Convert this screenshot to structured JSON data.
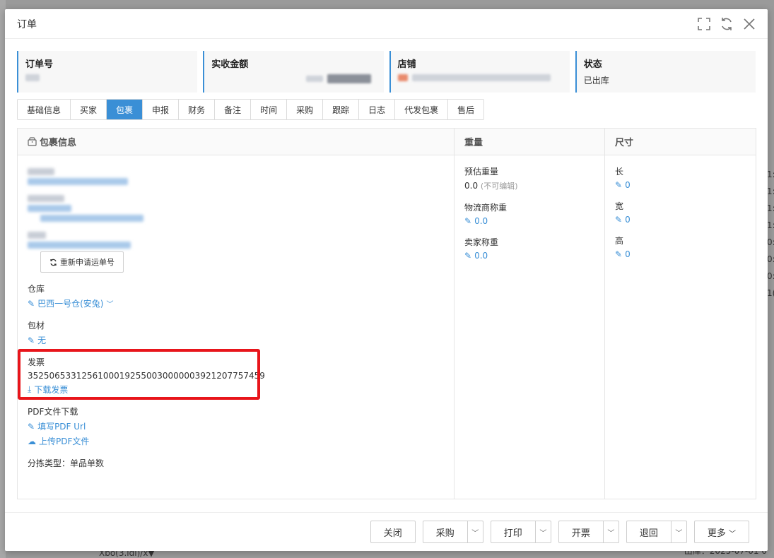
{
  "background": {
    "right_col": [
      "1:",
      "1:",
      "1:",
      "1:",
      "0:",
      "0:",
      "0:",
      "1("
    ],
    "bottom_left": "Xbo(3.ldi)/x▼",
    "bottom_right": "出库：2025-07-01 0"
  },
  "modal": {
    "title": "订单",
    "icons": {
      "fullscreen": "fullscreen-icon",
      "refresh": "refresh-icon",
      "close": "close-icon"
    }
  },
  "summary": {
    "order_no": {
      "label": "订单号"
    },
    "amount": {
      "label": "实收金额"
    },
    "shop": {
      "label": "店铺"
    },
    "status": {
      "label": "状态",
      "value": "已出库"
    }
  },
  "tabs": [
    {
      "label": "基础信息"
    },
    {
      "label": "买家"
    },
    {
      "label": "包裹",
      "active": true
    },
    {
      "label": "申报"
    },
    {
      "label": "财务"
    },
    {
      "label": "备注"
    },
    {
      "label": "时间"
    },
    {
      "label": "采购"
    },
    {
      "label": "跟踪"
    },
    {
      "label": "日志"
    },
    {
      "label": "代发包裹"
    },
    {
      "label": "售后"
    }
  ],
  "package_info": {
    "header": "包裹信息",
    "reapply_button": "重新申请运单号",
    "warehouse": {
      "label": "仓库",
      "value": "巴西一号仓(安兔)"
    },
    "packaging": {
      "label": "包材",
      "value": "无"
    },
    "invoice": {
      "label": "发票",
      "value": "35250653312561000192550030000003921207757459",
      "download": "下载发票"
    },
    "pdf": {
      "label": "PDF文件下载",
      "fill_url": "填写PDF Url",
      "upload": "上传PDF文件"
    },
    "sort_type": "分拣类型：单品单数"
  },
  "weight": {
    "header": "重量",
    "estimated": {
      "label": "预估重量",
      "value": "0.0",
      "note": "(不可编辑)"
    },
    "carrier": {
      "label": "物流商称重",
      "value": "0.0"
    },
    "seller": {
      "label": "卖家称重",
      "value": "0.0"
    }
  },
  "size": {
    "header": "尺寸",
    "length": {
      "label": "长",
      "value": "0"
    },
    "width": {
      "label": "宽",
      "value": "0"
    },
    "height": {
      "label": "高",
      "value": "0"
    }
  },
  "footer": {
    "close": "关闭",
    "purchase": "采购",
    "print": "打印",
    "invoice": "开票",
    "return": "退回",
    "more": "更多"
  },
  "colors": {
    "accent": "#3a8fd6",
    "highlight": "#e8151b"
  }
}
